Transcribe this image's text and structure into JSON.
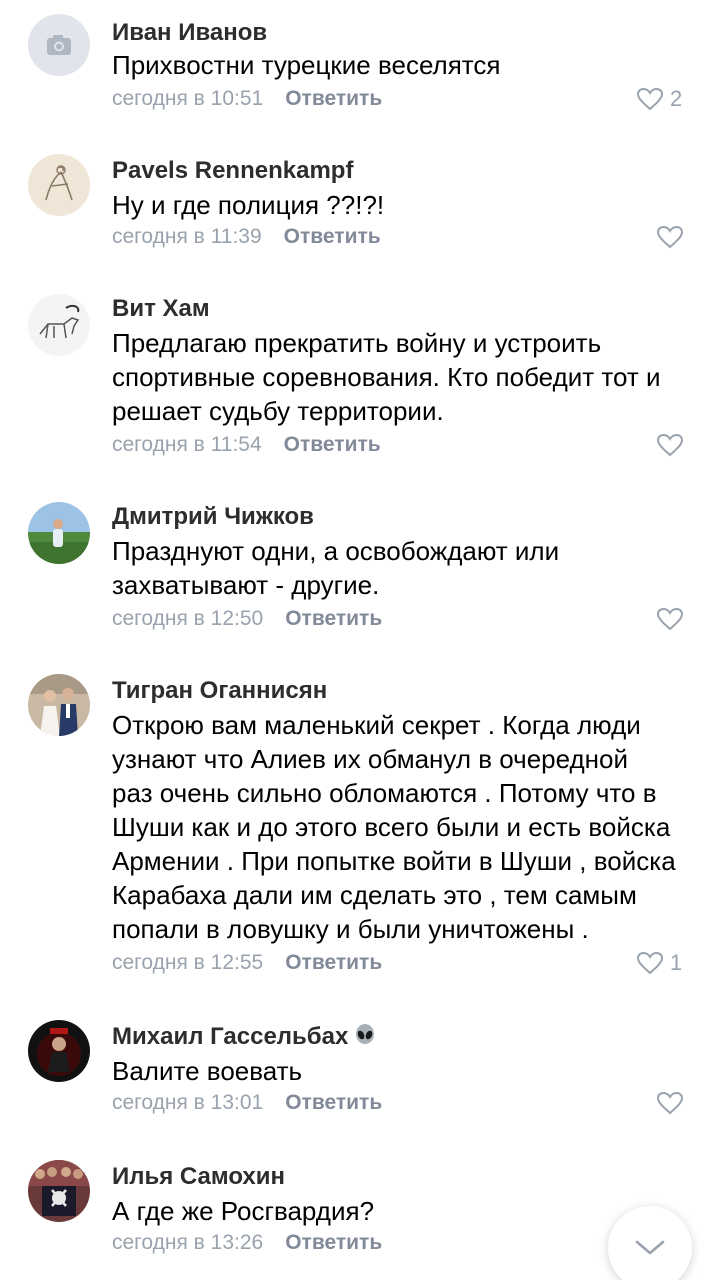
{
  "reply_label": "Ответить",
  "comments": [
    {
      "author": "Иван Иванов",
      "lines": [
        "Прихвостни турецкие веселятся"
      ],
      "time": "сегодня в 10:51",
      "likes": "2",
      "avatar_icon": "camera-icon"
    },
    {
      "author": "Pavels Rennenkampf",
      "lines": [
        "Ну и где полиция ??!?!"
      ],
      "time": "сегодня в 11:39",
      "likes": "",
      "avatar_icon": "sketch-avatar"
    },
    {
      "author": "Вит Хам",
      "lines": [
        "Предлагаю прекратить войну и устроить",
        "спортивные соревнования. Кто победит тот и",
        "решает судьбу территории."
      ],
      "time": "сегодня в 11:54",
      "likes": "",
      "avatar_icon": "animal-sketch-avatar"
    },
    {
      "author": "Дмитрий Чижков",
      "lines": [
        "Празднуют одни, а освобождают или",
        "захватывают - другие."
      ],
      "time": "сегодня в 12:50",
      "likes": "",
      "avatar_icon": "outdoor-photo-avatar"
    },
    {
      "author": "Тигран Оганнисян",
      "lines": [
        "Открою вам маленький секрет . Когда люди",
        "узнают что Алиев их обманул в очередной",
        "раз очень сильно обломаются . Потому что в",
        "Шуши как и до этого всего были и есть войска",
        "Армении . При попытке войти в Шуши , войска",
        "Карабаха дали им сделать это , тем самым",
        "попали в ловушку и были уничтожены ."
      ],
      "time": "сегодня в 12:55",
      "likes": "1",
      "avatar_icon": "couple-photo-avatar"
    },
    {
      "author": "Михаил Гассельбах",
      "author_emoji": "alien-icon",
      "lines": [
        "Валите воевать"
      ],
      "time": "сегодня в 13:01",
      "likes": "",
      "avatar_icon": "dark-photo-avatar"
    },
    {
      "author": "Илья Самохин",
      "lines": [
        "А где же Росгвардия?"
      ],
      "time": "сегодня в 13:26",
      "likes": "",
      "avatar_icon": "group-photo-avatar"
    }
  ],
  "scroll_button_icon": "chevron-down-icon",
  "colors": {
    "meta": "#99a2ad",
    "reply": "#828a99",
    "author": "#2c2d2e"
  }
}
